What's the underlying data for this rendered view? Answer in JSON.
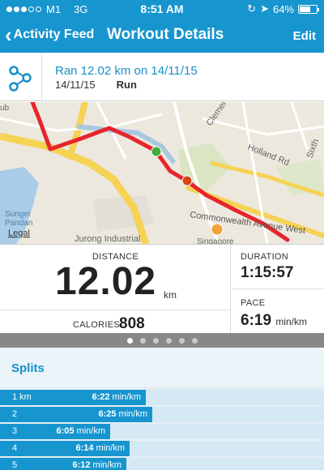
{
  "status_bar": {
    "carrier": "M1",
    "network": "3G",
    "time": "8:51 AM",
    "battery_percent": "64%",
    "battery_level": 0.64
  },
  "nav": {
    "back_label": "Activity Feed",
    "title": "Workout Details",
    "edit_label": "Edit"
  },
  "activity": {
    "icon": "route-icon",
    "title": "Ran 12.02 km on 14/11/15",
    "date": "14/11/15",
    "type": "Run"
  },
  "map": {
    "labels": [
      "Clemen",
      "Sixth",
      "Holland Rd",
      "Commonwealth Avenue West",
      "Sungei Pandan",
      "Legal",
      "Jurong Industrial",
      "Singapore",
      "ub"
    ],
    "route_color": "#e8242c",
    "start_marker_color": "#3fae3a",
    "end_marker_color": "#d9441a"
  },
  "stats": {
    "distance_label": "DISTANCE",
    "distance_value": "12.02",
    "distance_unit": "km",
    "calories_label": "CALORIES",
    "calories_value": "808",
    "duration_label": "DURATION",
    "duration_value": "1:15:57",
    "pace_label": "PACE",
    "pace_value": "6:19",
    "pace_unit": "min/km"
  },
  "pager": {
    "count": 6,
    "active": 0
  },
  "splits": {
    "title": "Splits",
    "unit": "min/km",
    "rows": [
      {
        "km": "1 km",
        "pace": "6:22",
        "fraction": 0.45
      },
      {
        "km": "2",
        "pace": "6:25",
        "fraction": 0.47
      },
      {
        "km": "3",
        "pace": "6:05",
        "fraction": 0.34
      },
      {
        "km": "4",
        "pace": "6:14",
        "fraction": 0.4
      },
      {
        "km": "5",
        "pace": "6:12",
        "fraction": 0.39
      }
    ]
  },
  "colors": {
    "accent": "#1795cf",
    "link": "#1a8fc9"
  }
}
